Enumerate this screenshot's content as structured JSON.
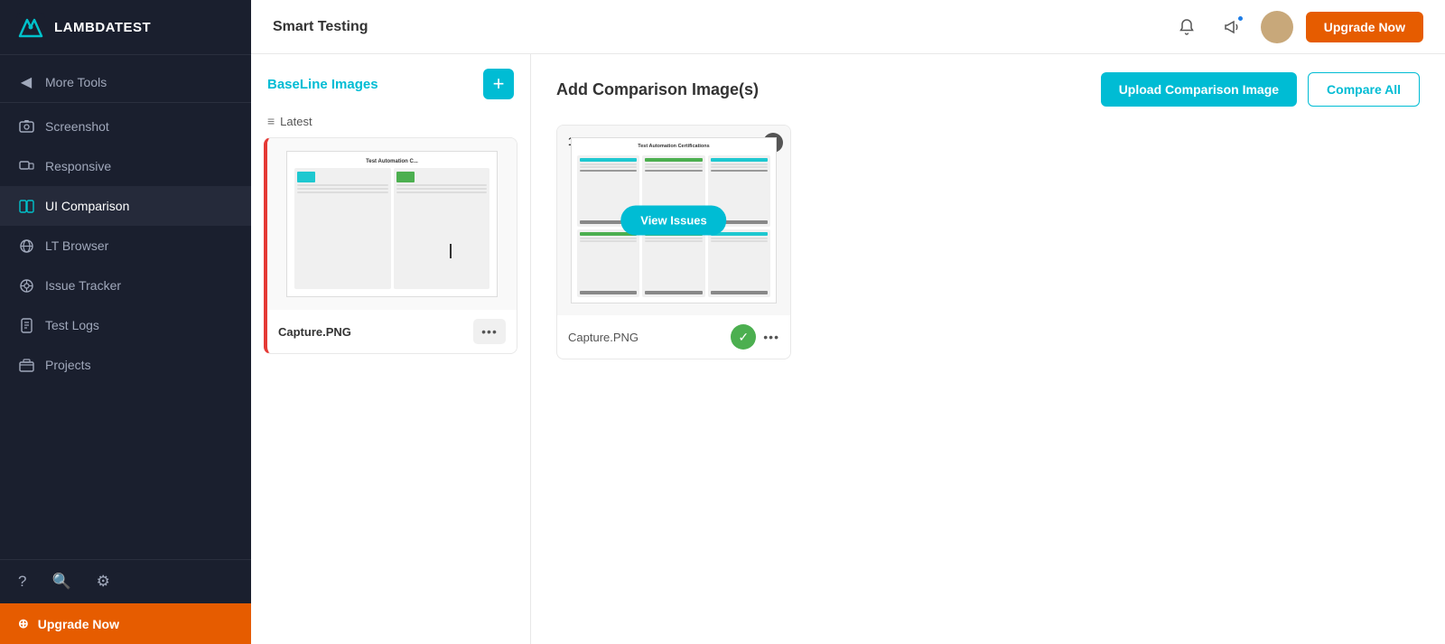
{
  "app": {
    "name": "LAMBDATEST"
  },
  "topbar": {
    "title": "Smart Testing",
    "upgrade_label": "Upgrade Now"
  },
  "sidebar": {
    "more_tools": "More Tools",
    "items": [
      {
        "id": "more-tools",
        "label": "More Tools",
        "icon": "◀"
      },
      {
        "id": "screenshot",
        "label": "Screenshot",
        "icon": "🖼"
      },
      {
        "id": "responsive",
        "label": "Responsive",
        "icon": "⊡"
      },
      {
        "id": "ui-comparison",
        "label": "UI Comparison",
        "icon": "⊞",
        "active": true
      },
      {
        "id": "lt-browser",
        "label": "LT Browser",
        "icon": "🌐"
      },
      {
        "id": "issue-tracker",
        "label": "Issue Tracker",
        "icon": "⚙"
      },
      {
        "id": "test-logs",
        "label": "Test Logs",
        "icon": "📄"
      },
      {
        "id": "projects",
        "label": "Projects",
        "icon": "📁"
      }
    ],
    "upgrade_label": "Upgrade Now"
  },
  "baseline": {
    "title": "BaseLine Images",
    "add_label": "+",
    "filter_label": "Latest",
    "item_name": "Capture.PNG",
    "more_dots": "•••"
  },
  "comparison": {
    "title": "Add Comparison Image(s)",
    "upload_btn": "Upload Comparison Image",
    "compare_all_btn": "Compare All",
    "card": {
      "number": "1",
      "title": "Test Automation Certifications",
      "name": "Capture.PNG",
      "view_issues": "View Issues",
      "more_dots": "•••"
    }
  }
}
